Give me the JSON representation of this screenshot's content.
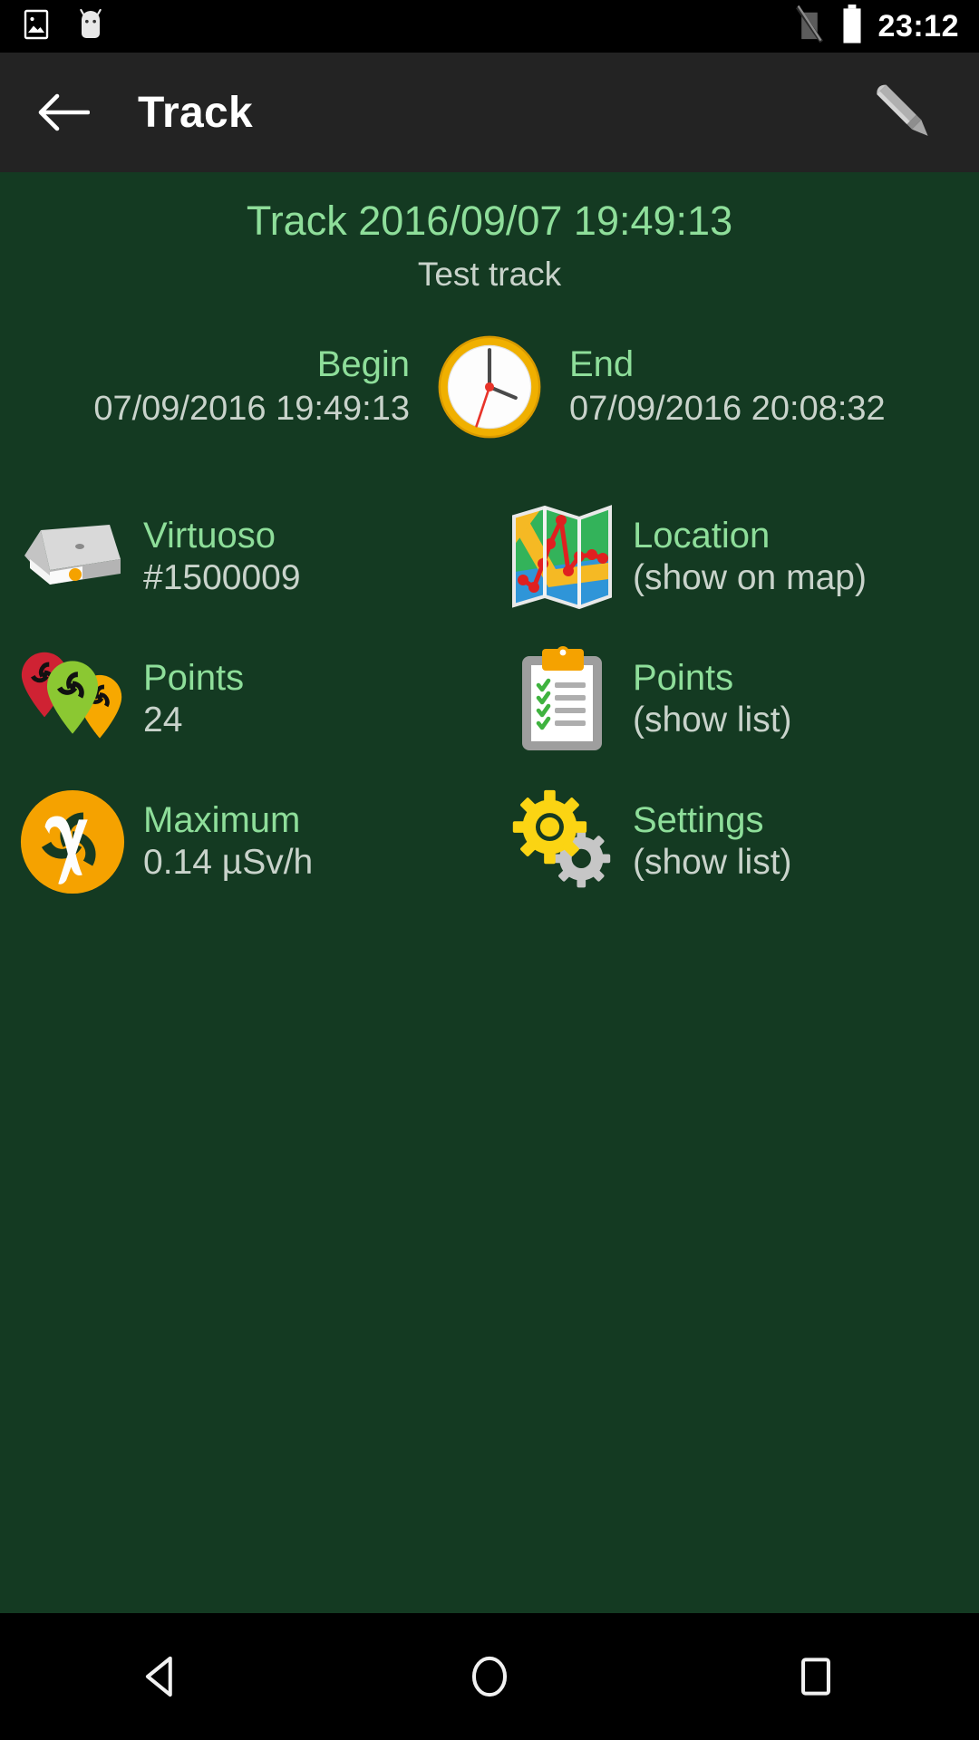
{
  "status_bar": {
    "icons": [
      "image-icon",
      "android-mascot-icon",
      "no-sim-icon",
      "battery-icon"
    ],
    "time": "23:12"
  },
  "app_bar": {
    "back_icon": "back-arrow-icon",
    "title": "Track",
    "edit_icon": "pencil-icon"
  },
  "track": {
    "title": "Track 2016/09/07 19:49:13",
    "subtitle": "Test track",
    "begin_label": "Begin",
    "begin_value": "07/09/2016 19:49:13",
    "end_label": "End",
    "end_value": "07/09/2016 20:08:32",
    "clock_icon": "clock-icon"
  },
  "items": [
    {
      "icon": "hard-drive-icon",
      "label": "Virtuoso",
      "value": "#1500009"
    },
    {
      "icon": "map-icon",
      "label": "Location",
      "value": "(show on map)"
    },
    {
      "icon": "radiation-pins-icon",
      "label": "Points",
      "value": "24"
    },
    {
      "icon": "clipboard-checklist-icon",
      "label": "Points",
      "value": "(show list)"
    },
    {
      "icon": "gamma-radiation-icon",
      "label": "Maximum",
      "value": "0.14 µSv/h"
    },
    {
      "icon": "gears-icon",
      "label": "Settings",
      "value": "(show list)"
    }
  ],
  "nav_bar": {
    "back": "nav-back-icon",
    "home": "nav-home-icon",
    "recents": "nav-recents-icon"
  },
  "colors": {
    "background": "#143a22",
    "app_bar": "#232323",
    "status_bar": "#000000",
    "accent_green": "#8ede9a",
    "value_gray": "#c9d3cb"
  }
}
